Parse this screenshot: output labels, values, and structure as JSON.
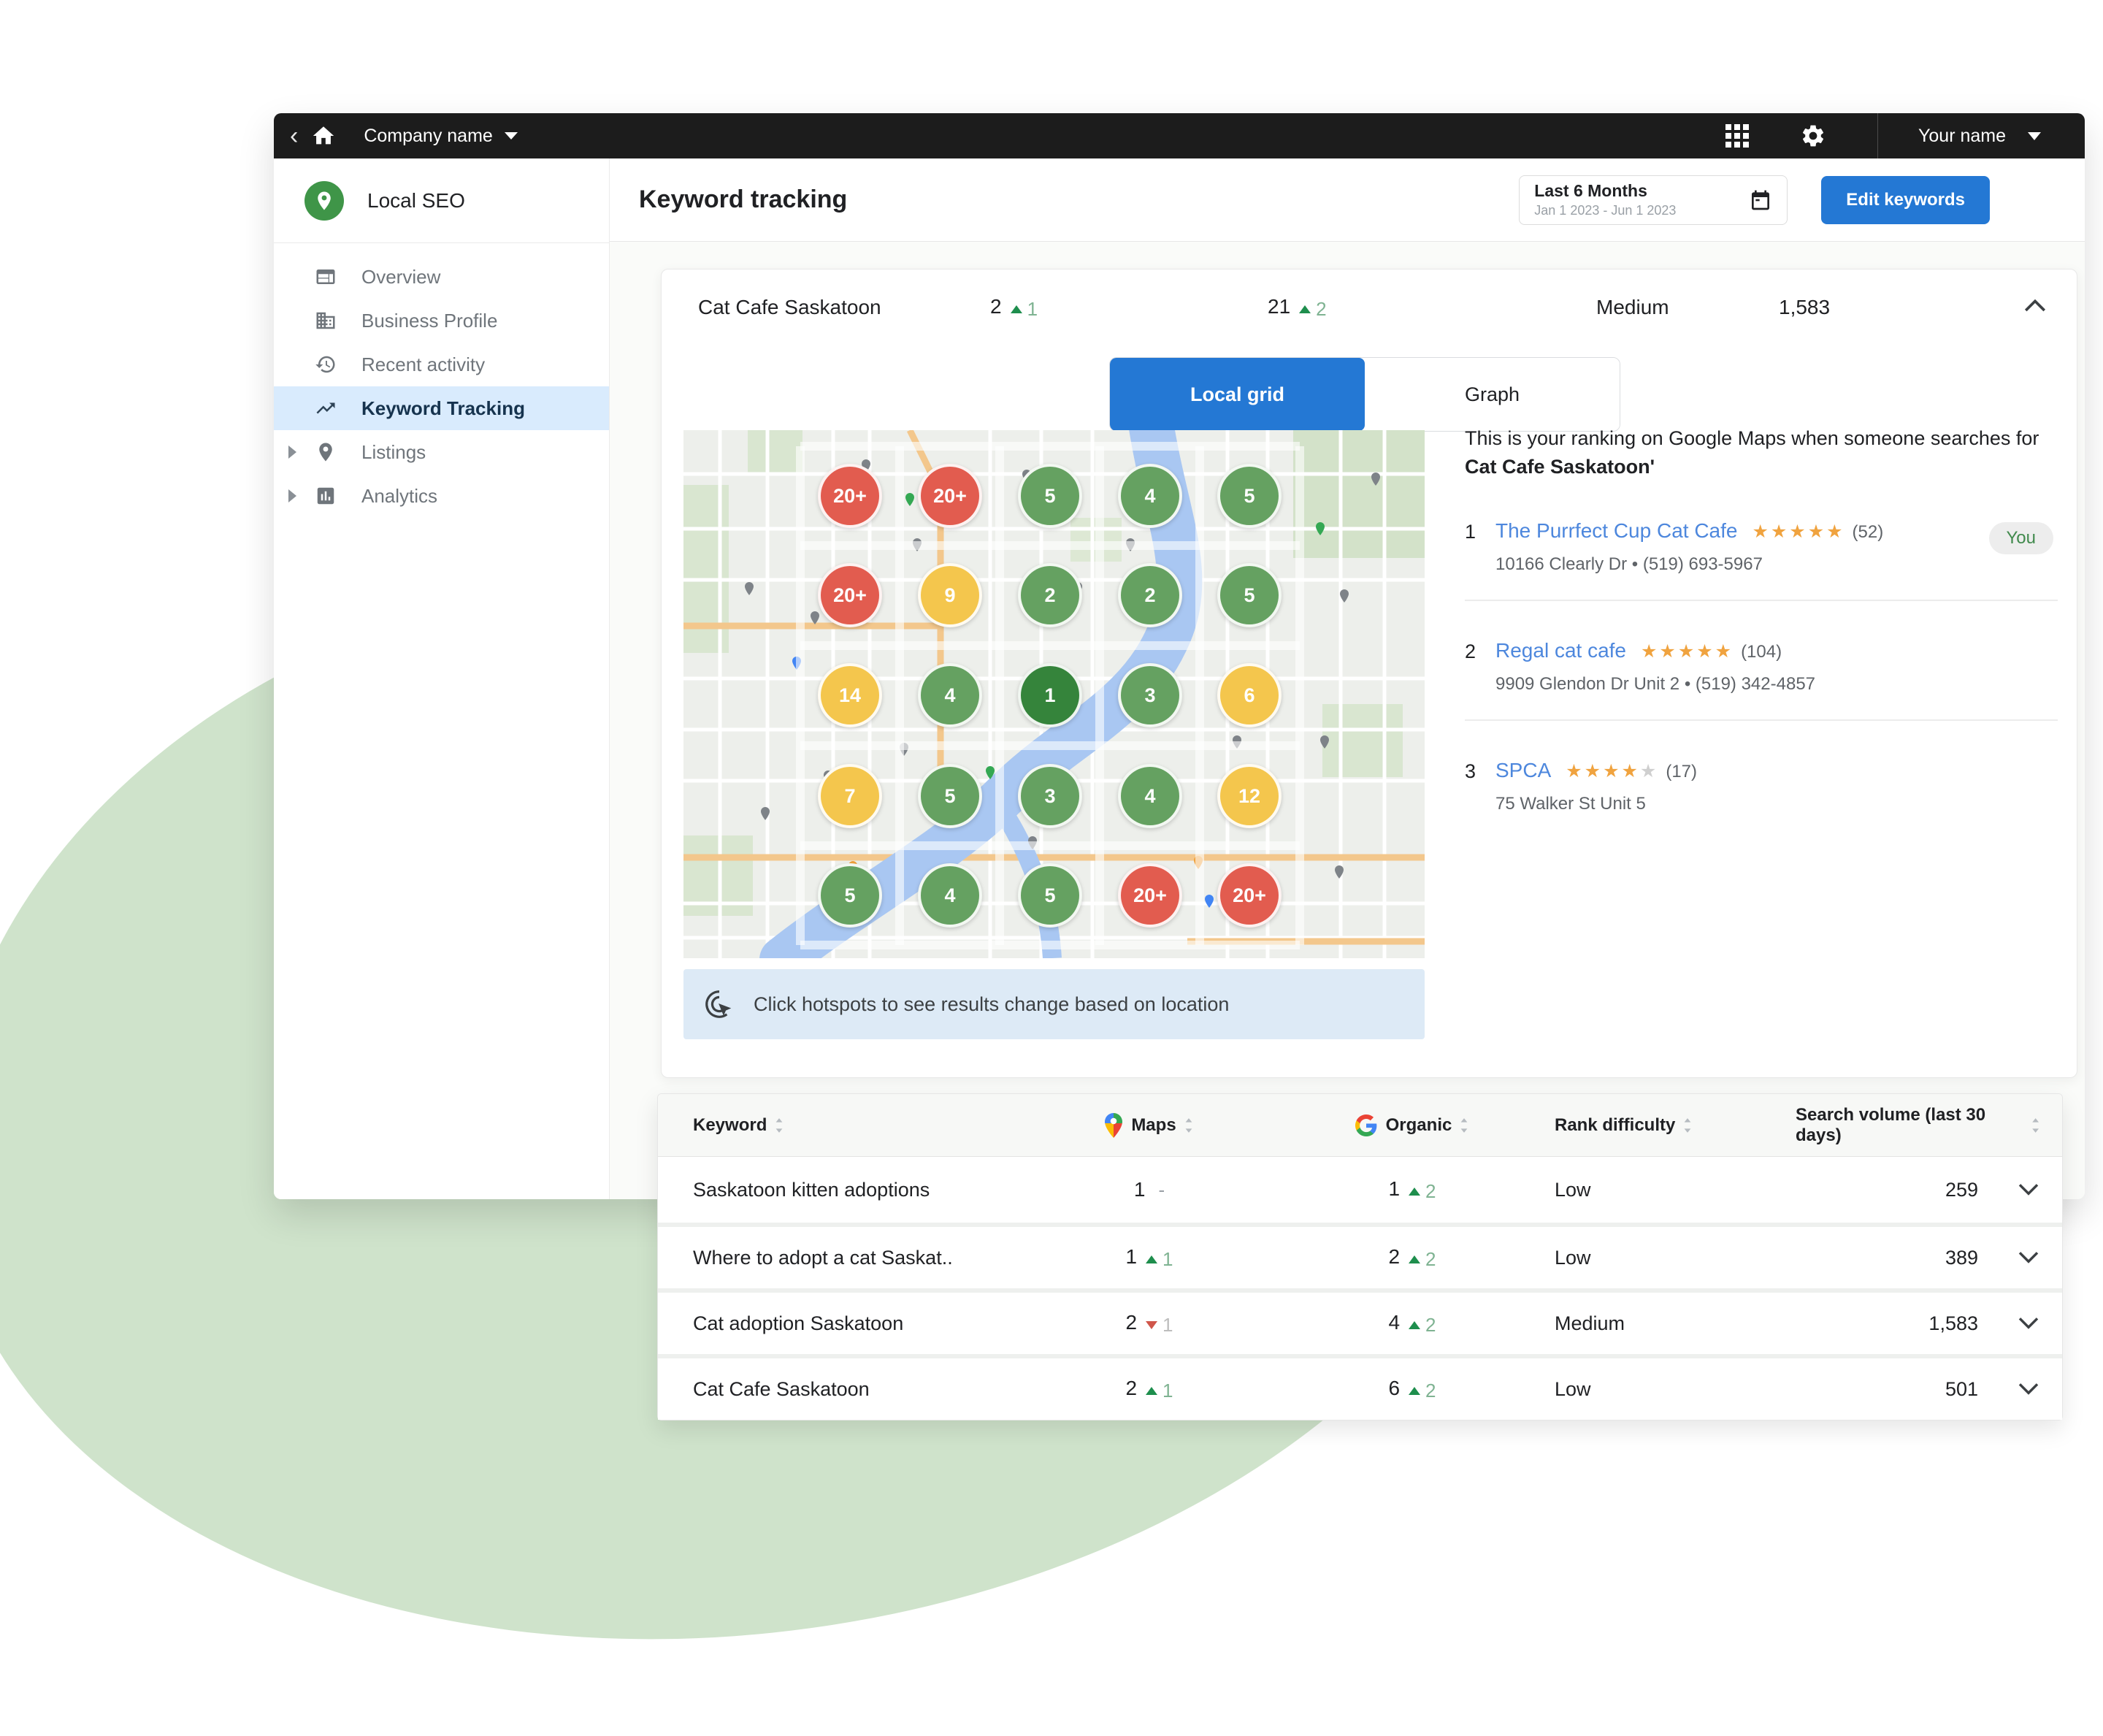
{
  "topbar": {
    "company": "Company name",
    "user": "Your name"
  },
  "sidebar": {
    "product": "Local SEO",
    "items": [
      {
        "label": "Overview"
      },
      {
        "label": "Business Profile"
      },
      {
        "label": "Recent activity"
      },
      {
        "label": "Keyword Tracking",
        "active": true
      },
      {
        "label": "Listings",
        "expandable": true
      },
      {
        "label": "Analytics",
        "expandable": true
      }
    ]
  },
  "header": {
    "title": "Keyword tracking",
    "date_label": "Last 6 Months",
    "date_range": "Jan 1 2023 - Jun 1 2023",
    "edit_button": "Edit keywords"
  },
  "card": {
    "keyword": "Cat Cafe Saskatoon",
    "maps_rank": {
      "value": "2",
      "change": "1",
      "dir": "up"
    },
    "organic_rank": {
      "value": "21",
      "change": "2",
      "dir": "up"
    },
    "difficulty": "Medium",
    "volume": "1,583",
    "tabs": [
      {
        "label": "Local grid"
      },
      {
        "label": "Graph"
      }
    ],
    "active_tab": "Local grid",
    "hint": "Click hotspots to see results change based on location",
    "grid": [
      {
        "v": "20+",
        "c": "red"
      },
      {
        "v": "20+",
        "c": "red"
      },
      {
        "v": "5",
        "c": "green"
      },
      {
        "v": "4",
        "c": "green"
      },
      {
        "v": "5",
        "c": "green"
      },
      {
        "v": "20+",
        "c": "red"
      },
      {
        "v": "9",
        "c": "yellow"
      },
      {
        "v": "2",
        "c": "green"
      },
      {
        "v": "2",
        "c": "green"
      },
      {
        "v": "5",
        "c": "green"
      },
      {
        "v": "14",
        "c": "yellow"
      },
      {
        "v": "4",
        "c": "green"
      },
      {
        "v": "1",
        "c": "dgreen"
      },
      {
        "v": "3",
        "c": "green"
      },
      {
        "v": "6",
        "c": "yellow"
      },
      {
        "v": "7",
        "c": "yellow"
      },
      {
        "v": "5",
        "c": "green"
      },
      {
        "v": "3",
        "c": "green"
      },
      {
        "v": "4",
        "c": "green"
      },
      {
        "v": "12",
        "c": "yellow"
      },
      {
        "v": "5",
        "c": "green"
      },
      {
        "v": "4",
        "c": "green"
      },
      {
        "v": "5",
        "c": "green"
      },
      {
        "v": "20+",
        "c": "red"
      },
      {
        "v": "20+",
        "c": "red"
      }
    ],
    "ranking": {
      "intro": "This is your ranking on Google Maps when someone searches for ",
      "intro_bold": "Cat Cafe Saskatoon'",
      "items": [
        {
          "rank": "1",
          "name": "The Purrfect Cup Cat Cafe",
          "stars_filled": "★★★★★",
          "stars_empty": "",
          "reviews": "(52)",
          "address": "10166 Clearly Dr • (519) 693-5967",
          "badge": "You"
        },
        {
          "rank": "2",
          "name": "Regal cat cafe",
          "stars_filled": "★★★★★",
          "stars_empty": "",
          "reviews": "(104)",
          "address": "9909 Glendon Dr Unit 2 • (519) 342-4857"
        },
        {
          "rank": "3",
          "name": "SPCA",
          "stars_filled": "★★★★",
          "stars_empty": "★",
          "reviews": "(17)",
          "address": "75 Walker St Unit 5"
        }
      ]
    }
  },
  "table": {
    "headers": {
      "keyword": "Keyword",
      "maps": "Maps",
      "organic": "Organic",
      "difficulty": "Rank difficulty",
      "volume": "Search volume (last 30 days)"
    },
    "rows": [
      {
        "keyword": "Saskatoon kitten adoptions",
        "maps": {
          "value": "1",
          "change": "-",
          "dir": "flat"
        },
        "organic": {
          "value": "1",
          "change": "2",
          "dir": "up"
        },
        "difficulty": "Low",
        "volume": "259"
      },
      {
        "keyword": "Where to adopt a cat Saskat..",
        "maps": {
          "value": "1",
          "change": "1",
          "dir": "up"
        },
        "organic": {
          "value": "2",
          "change": "2",
          "dir": "up"
        },
        "difficulty": "Low",
        "volume": "389"
      },
      {
        "keyword": "Cat adoption Saskatoon",
        "maps": {
          "value": "2",
          "change": "1",
          "dir": "down"
        },
        "organic": {
          "value": "4",
          "change": "2",
          "dir": "up"
        },
        "difficulty": "Medium",
        "volume": "1,583"
      },
      {
        "keyword": "Cat Cafe Saskatoon",
        "maps": {
          "value": "2",
          "change": "1",
          "dir": "up"
        },
        "organic": {
          "value": "6",
          "change": "2",
          "dir": "up"
        },
        "difficulty": "Low",
        "volume": "501"
      }
    ]
  },
  "colors": {
    "accent_blue": "#2478d4",
    "link_blue": "#4d87dd",
    "positive_green": "#1e8e4d",
    "negative_red": "#d0564a",
    "hotspot_red": "#e25c4f",
    "hotspot_yellow": "#f4c64d",
    "hotspot_green": "#65a161",
    "hotspot_dark_green": "#35843b",
    "star_orange": "#f0a33f",
    "blob_green": "#cfe3cb",
    "topbar_black": "#1c1c1c",
    "active_item_bg": "#d9ebfd",
    "hint_bg": "#ddeaf6"
  }
}
